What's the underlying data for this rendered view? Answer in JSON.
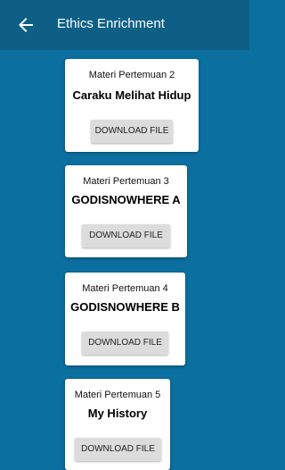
{
  "app_bar": {
    "title": "Ethics Enrichment",
    "back_icon": "arrow-left-icon",
    "background": "#0e5f86"
  },
  "page_background": "#0b6f9f",
  "cards": [
    {
      "subtitle": "Materi Pertemuan 2",
      "title": "Caraku Melihat Hidup",
      "button_label": "DOWNLOAD FILE"
    },
    {
      "subtitle": "Materi Pertemuan 3",
      "title": "GODISNOWHERE A",
      "button_label": "DOWNLOAD FILE"
    },
    {
      "subtitle": "Materi Pertemuan 4",
      "title": "GODISNOWHERE B",
      "button_label": "DOWNLOAD FILE"
    },
    {
      "subtitle": "Materi Pertemuan 5",
      "title": "My History",
      "button_label": "DOWNLOAD FILE"
    }
  ]
}
